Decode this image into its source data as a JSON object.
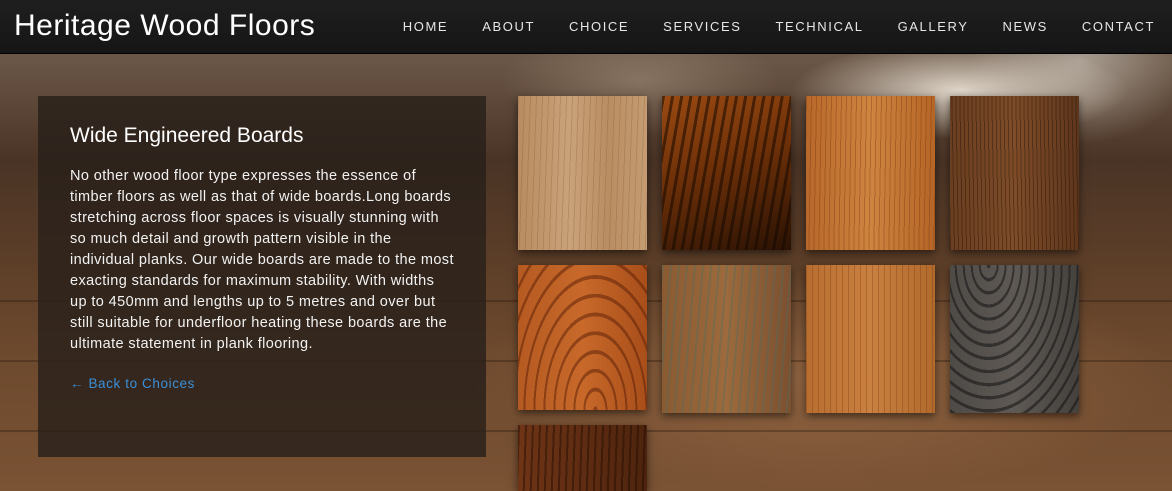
{
  "brand": {
    "title": "Heritage Wood Floors"
  },
  "nav": {
    "items": [
      {
        "label": "HOME"
      },
      {
        "label": "ABOUT"
      },
      {
        "label": "CHOICE"
      },
      {
        "label": "SERVICES"
      },
      {
        "label": "TECHNICAL"
      },
      {
        "label": "GALLERY"
      },
      {
        "label": "NEWS"
      },
      {
        "label": "CONTACT"
      }
    ]
  },
  "panel": {
    "heading": "Wide Engineered Boards",
    "body": "No other wood floor type expresses the essence of timber floors as well as that of wide boards.Long boards stretching across floor spaces is visually stunning with so much detail and growth pattern visible in the individual planks. Our wide boards are made to the most exacting standards for maximum stability. With widths up to 450mm and lengths up to 5 metres and over but still suitable for underfloor heating these boards are the ultimate statement in plank flooring.",
    "back_link": "← Back to Choices"
  },
  "colors": {
    "navbar": "#1a1a1a",
    "link": "#3a8fd8"
  }
}
